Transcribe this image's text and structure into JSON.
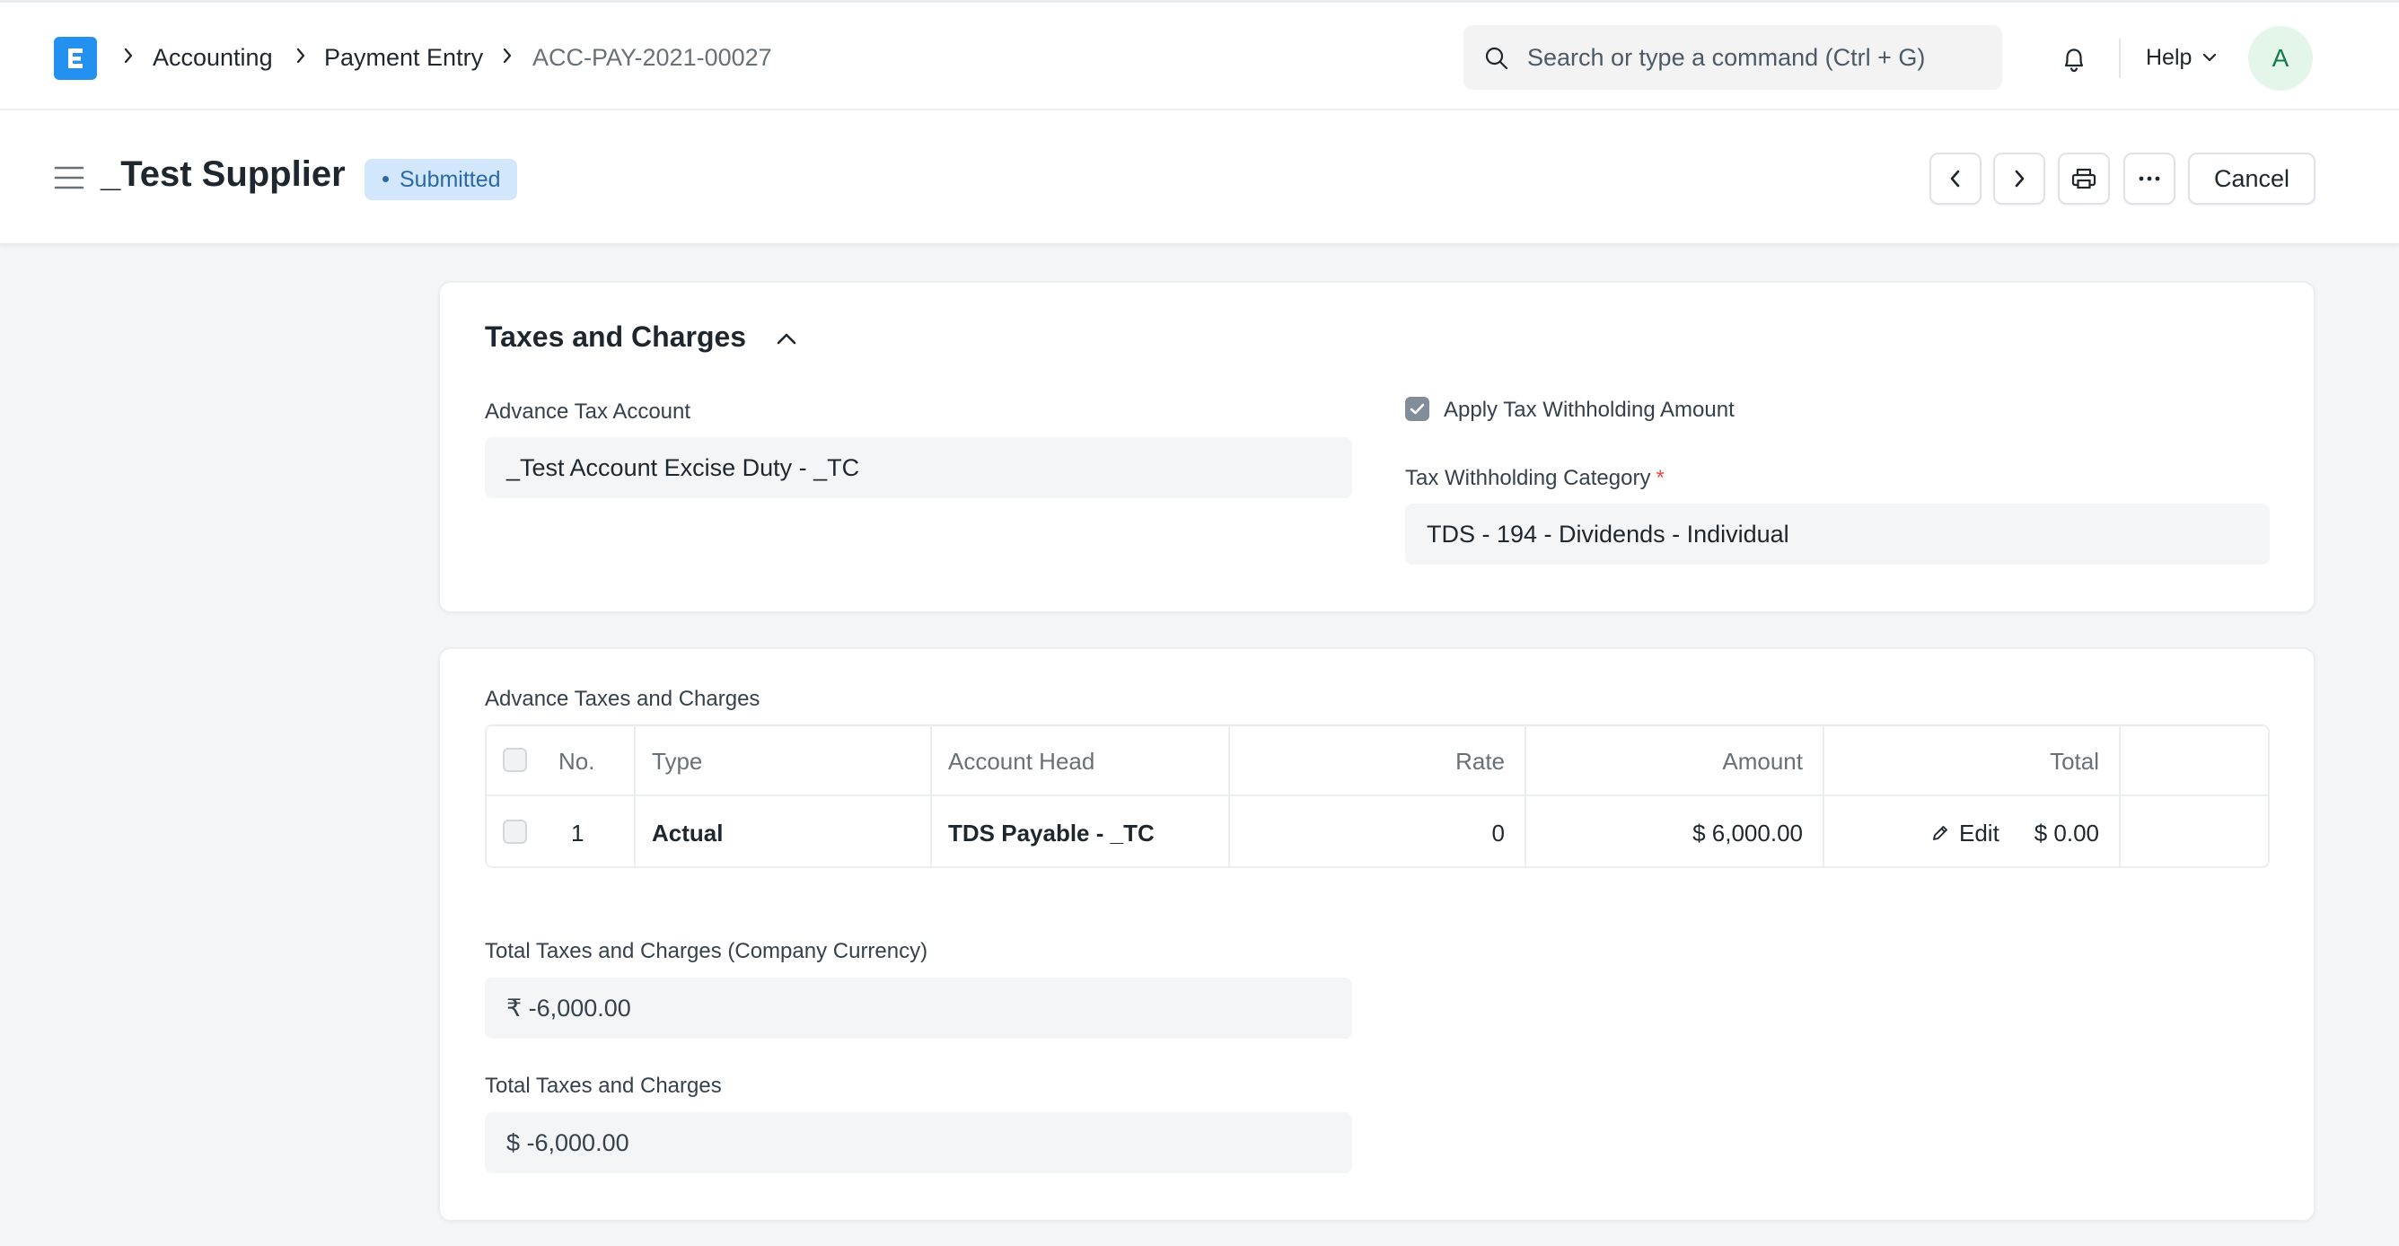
{
  "navbar": {
    "breadcrumbs": [
      "Accounting",
      "Payment Entry",
      "ACC-PAY-2021-00027"
    ],
    "search_placeholder": "Search or type a command (Ctrl + G)",
    "help_label": "Help",
    "avatar_initial": "A"
  },
  "page_head": {
    "title": "_Test Supplier",
    "status": "Submitted",
    "cancel_label": "Cancel"
  },
  "taxes_section": {
    "title": "Taxes and Charges",
    "advance_tax_account_label": "Advance Tax Account",
    "advance_tax_account_value": "_Test Account Excise Duty - _TC",
    "apply_tax_withholding_label": "Apply Tax Withholding Amount",
    "apply_tax_withholding_checked": true,
    "tax_withholding_category_label": "Tax Withholding Category",
    "tax_withholding_category_required": "*",
    "tax_withholding_category_value": "TDS - 194 - Dividends - Individual"
  },
  "advance_taxes": {
    "label": "Advance Taxes and Charges",
    "columns": [
      "No.",
      "Type",
      "Account Head",
      "Rate",
      "Amount",
      "Total"
    ],
    "rows": [
      {
        "no": "1",
        "type": "Actual",
        "account_head": "TDS Payable - _TC",
        "rate": "0",
        "amount": "$ 6,000.00",
        "total": "$ 0.00",
        "edit_label": "Edit"
      }
    ],
    "total_company_currency_label": "Total Taxes and Charges (Company Currency)",
    "total_company_currency_value": "₹ -6,000.00",
    "total_label": "Total Taxes and Charges",
    "total_value": "$ -6,000.00"
  },
  "colors": {
    "brand": "#2490ef",
    "status_badge_bg": "#d2e7fb",
    "status_badge_text": "#2b69a6",
    "avatar_bg": "#e4f5e9",
    "avatar_text": "#16794c",
    "required": "#e24c4c"
  },
  "icons": [
    "app-logo-icon",
    "chevron-right-icon",
    "search-icon",
    "bell-icon",
    "chevron-down-icon",
    "hamburger-icon",
    "chevron-left-icon",
    "printer-icon",
    "ellipsis-icon",
    "chevron-up-icon",
    "check-icon",
    "pencil-icon"
  ]
}
